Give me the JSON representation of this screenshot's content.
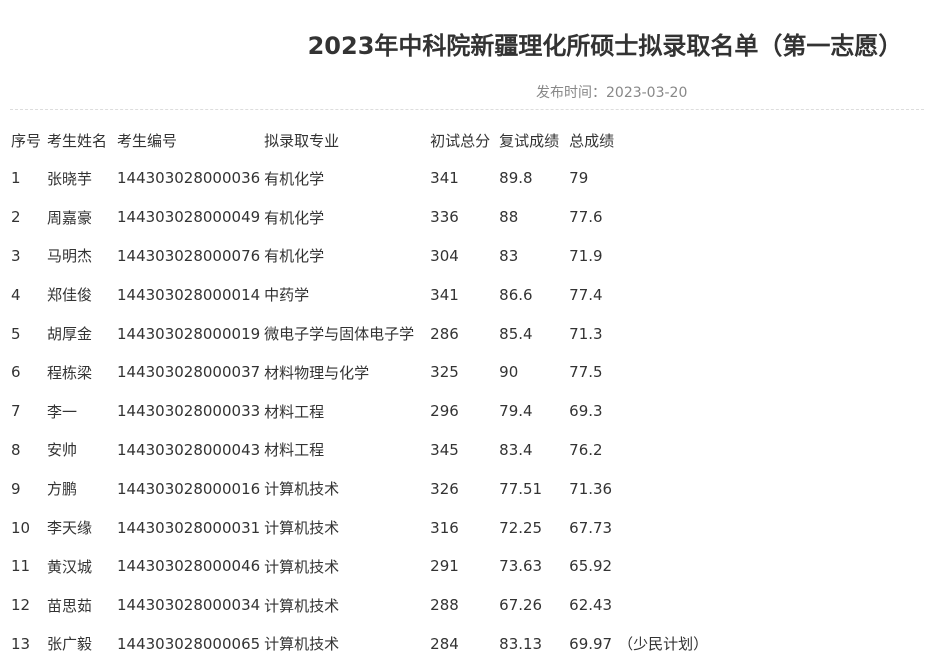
{
  "article": {
    "title": "2023年中科院新疆理化所硕士拟录取名单（第一志愿）",
    "publish_label": "发布时间：",
    "publish_date": "2023-03-20"
  },
  "table": {
    "headers": [
      "序号",
      "考生姓名",
      "考生编号",
      "拟录取专业",
      "初试总分",
      "复试成绩",
      "总成绩"
    ],
    "rows": [
      {
        "no": "1",
        "name": "张晓芋",
        "id": "144303028000036",
        "major": "有机化学",
        "initial": "341",
        "retest": "89.8",
        "total": "79",
        "note": ""
      },
      {
        "no": "2",
        "name": "周嘉豪",
        "id": "144303028000049",
        "major": "有机化学",
        "initial": "336",
        "retest": "88",
        "total": "77.6",
        "note": ""
      },
      {
        "no": "3",
        "name": "马明杰",
        "id": "144303028000076",
        "major": "有机化学",
        "initial": "304",
        "retest": "83",
        "total": "71.9",
        "note": ""
      },
      {
        "no": "4",
        "name": "郑佳俊",
        "id": "144303028000014",
        "major": "中药学",
        "initial": "341",
        "retest": "86.6",
        "total": "77.4",
        "note": ""
      },
      {
        "no": "5",
        "name": "胡厚金",
        "id": "144303028000019",
        "major": "微电子学与固体电子学",
        "initial": "286",
        "retest": "85.4",
        "total": "71.3",
        "note": ""
      },
      {
        "no": "6",
        "name": "程栋梁",
        "id": "144303028000037",
        "major": "材料物理与化学",
        "initial": "325",
        "retest": "90",
        "total": "77.5",
        "note": ""
      },
      {
        "no": "7",
        "name": "李一",
        "id": "144303028000033",
        "major": "材料工程",
        "initial": "296",
        "retest": "79.4",
        "total": "69.3",
        "note": ""
      },
      {
        "no": "8",
        "name": "安帅",
        "id": "144303028000043",
        "major": "材料工程",
        "initial": "345",
        "retest": "83.4",
        "total": "76.2",
        "note": ""
      },
      {
        "no": "9",
        "name": "方鹏",
        "id": "144303028000016",
        "major": "计算机技术",
        "initial": "326",
        "retest": "77.51",
        "total": "71.36",
        "note": ""
      },
      {
        "no": "10",
        "name": "李天缘",
        "id": "144303028000031",
        "major": "计算机技术",
        "initial": "316",
        "retest": "72.25",
        "total": "67.73",
        "note": ""
      },
      {
        "no": "11",
        "name": "黄汉城",
        "id": "144303028000046",
        "major": "计算机技术",
        "initial": "291",
        "retest": "73.63",
        "total": "65.92",
        "note": ""
      },
      {
        "no": "12",
        "name": "苗思茹",
        "id": "144303028000034",
        "major": "计算机技术",
        "initial": "288",
        "retest": "67.26",
        "total": "62.43",
        "note": ""
      },
      {
        "no": "13",
        "name": "张广毅",
        "id": "144303028000065",
        "major": "计算机技术",
        "initial": "284",
        "retest": "83.13",
        "total": "69.97",
        "note": "（少民计划）"
      }
    ]
  }
}
